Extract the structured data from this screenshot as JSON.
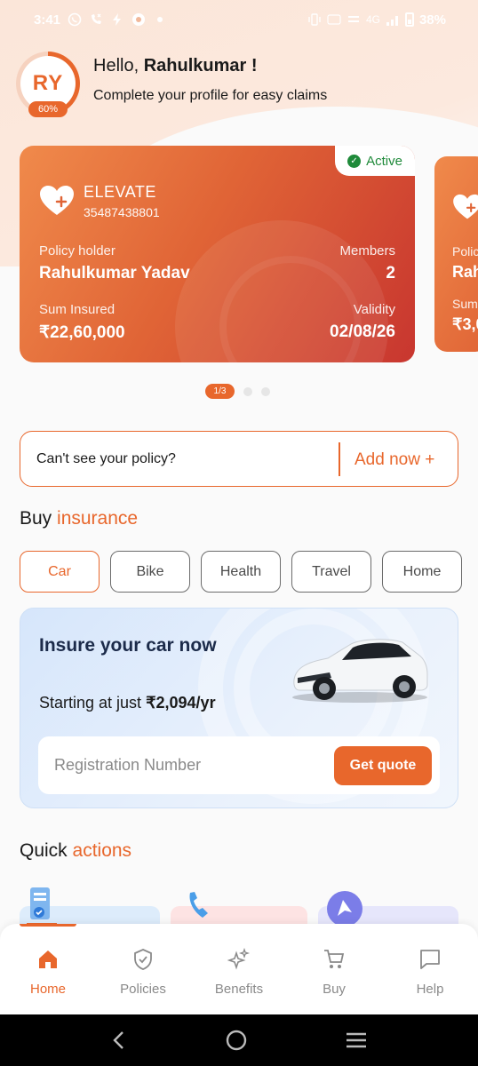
{
  "status_bar": {
    "time": "3:41",
    "network": "4G",
    "battery": "38%"
  },
  "profile": {
    "initials": "RY",
    "completion": "60%",
    "completion_fraction": 0.6,
    "greeting_prefix": "Hello,",
    "name": "Rahulkumar !",
    "subtitle": "Complete your profile for easy claims"
  },
  "policy_card": {
    "status": "Active",
    "plan": "ELEVATE",
    "policy_number": "35487438801",
    "holder_label": "Policy holder",
    "holder": "Rahulkumar Yadav",
    "members_label": "Members",
    "members": "2",
    "sum_label": "Sum Insured",
    "sum": "₹22,60,000",
    "validity_label": "Validity",
    "validity": "02/08/26"
  },
  "next_card_peek": {
    "holder_label": "Polic",
    "holder": "Rah",
    "sum_label": "Sum",
    "sum": "₹3,0"
  },
  "pager": {
    "current": "1/3"
  },
  "missing_policy": {
    "text": "Can't see your policy?",
    "action": "Add now +"
  },
  "buy_insurance": {
    "title_plain": "Buy ",
    "title_accent": "insurance",
    "chips": [
      "Car",
      "Bike",
      "Health",
      "Travel",
      "Home"
    ],
    "selected": "Car"
  },
  "car_promo": {
    "title": "Insure your car now",
    "subtitle_prefix": "Starting at just ",
    "price": "₹2,094/yr",
    "placeholder": "Registration Number",
    "button": "Get quote"
  },
  "quick_actions": {
    "title_plain": "Quick ",
    "title_accent": "actions"
  },
  "bottom_nav": {
    "items": [
      {
        "label": "Home",
        "icon": "home-icon"
      },
      {
        "label": "Policies",
        "icon": "shield-check-icon"
      },
      {
        "label": "Benefits",
        "icon": "sparkles-icon"
      },
      {
        "label": "Buy",
        "icon": "cart-icon"
      },
      {
        "label": "Help",
        "icon": "chat-icon"
      }
    ],
    "active": "Home"
  },
  "colors": {
    "accent": "#e8672c",
    "active_green": "#1f8a3a",
    "promo_title": "#1c2b4a"
  }
}
